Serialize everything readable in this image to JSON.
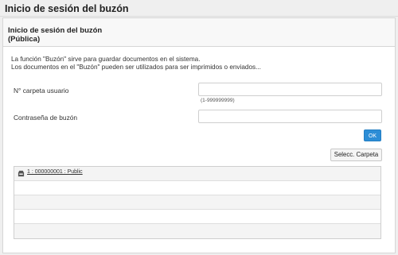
{
  "page": {
    "title": "Inicio de sesión del buzón"
  },
  "panel": {
    "title": "Inicio de sesión del buzón",
    "subtitle": "(Pública)",
    "description_line1": "La función \"Buzón\" sirve para guardar documentos en el sistema.",
    "description_line2": "Los documentos en el \"Buzón\" pueden ser utilizados para ser imprimidos o enviados..."
  },
  "form": {
    "folder_label": "N° carpeta usuario",
    "folder_value": "",
    "folder_hint": "(1-999999999)",
    "password_label": "Contraseña de buzón",
    "password_value": "",
    "ok_label": "OK",
    "select_folder_label": "Selecc. Carpeta"
  },
  "folder_list": {
    "rows": [
      {
        "label": "1 : 000000001 : Public",
        "icon": "inbox-icon"
      },
      {
        "label": ""
      },
      {
        "label": ""
      },
      {
        "label": ""
      },
      {
        "label": ""
      }
    ]
  },
  "colors": {
    "accent": "#2c8dd6",
    "background": "#efefef",
    "panel": "#ffffff"
  }
}
